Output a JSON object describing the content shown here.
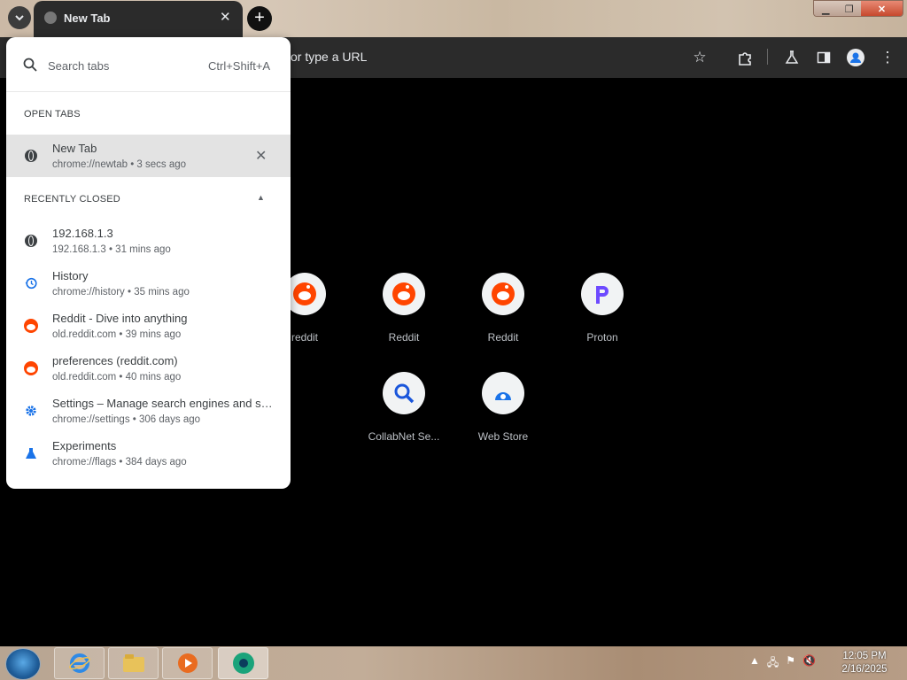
{
  "browser": {
    "tab": {
      "title": "New Tab"
    },
    "omnibox": {
      "text": "or type a URL"
    }
  },
  "tab_search": {
    "search_placeholder": "Search tabs",
    "shortcut": "Ctrl+Shift+A",
    "open_tabs_header": "OPEN TABS",
    "open_tabs": [
      {
        "title": "New Tab",
        "subtitle": "chrome://newtab • 3 secs ago",
        "icon": "globe-icon"
      }
    ],
    "recently_closed_header": "RECENTLY CLOSED",
    "recently_closed": [
      {
        "title": "192.168.1.3",
        "subtitle": "192.168.1.3 • 31 mins ago",
        "icon": "globe-icon"
      },
      {
        "title": "History",
        "subtitle": "chrome://history • 35 mins ago",
        "icon": "history-icon"
      },
      {
        "title": "Reddit - Dive into anything",
        "subtitle": "old.reddit.com • 39 mins ago",
        "icon": "reddit-icon"
      },
      {
        "title": "preferences (reddit.com)",
        "subtitle": "old.reddit.com • 40 mins ago",
        "icon": "reddit-icon"
      },
      {
        "title": "Settings – Manage search engines and sit...",
        "subtitle": "chrome://settings • 306 days ago",
        "icon": "settings-icon"
      },
      {
        "title": "Experiments",
        "subtitle": "chrome://flags • 384 days ago",
        "icon": "flask-icon"
      }
    ]
  },
  "shortcuts": [
    {
      "label": "reddit",
      "icon": "reddit-icon"
    },
    {
      "label": "Reddit",
      "icon": "reddit-icon"
    },
    {
      "label": "Reddit",
      "icon": "reddit-icon"
    },
    {
      "label": "Proton",
      "icon": "proton-icon"
    },
    {
      "label": "CollabNet Se...",
      "icon": "search-icon"
    },
    {
      "label": "Web Store",
      "icon": "webstore-icon"
    }
  ],
  "taskbar": {
    "time": "12:05 PM",
    "date": "2/16/2025"
  },
  "colors": {
    "accent_blue": "#1a73e8",
    "reddit_orange": "#ff4500",
    "proton_purple": "#6d4aff",
    "toolbar_dark": "#2b2b2b"
  }
}
